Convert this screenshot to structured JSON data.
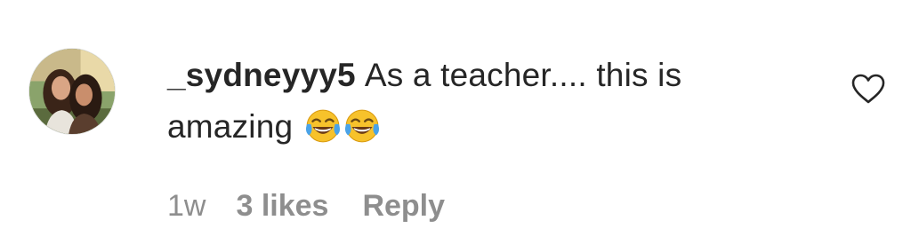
{
  "comment": {
    "username": "_sydneyyy5",
    "text_line1": "As a teacher.... this is",
    "text_line2": "amazing",
    "emojis": [
      "face-with-tears-of-joy-icon",
      "face-with-tears-of-joy-icon"
    ],
    "avatar": "profile-photo-avatar",
    "like_icon": "heart-outline-icon"
  },
  "meta": {
    "time": "1w",
    "likes": "3 likes",
    "reply": "Reply"
  },
  "colors": {
    "text": "#262626",
    "secondary": "#8e8e8e",
    "background": "#ffffff",
    "emoji_face": "#f7c22b",
    "emoji_tears": "#4aa3e8"
  }
}
